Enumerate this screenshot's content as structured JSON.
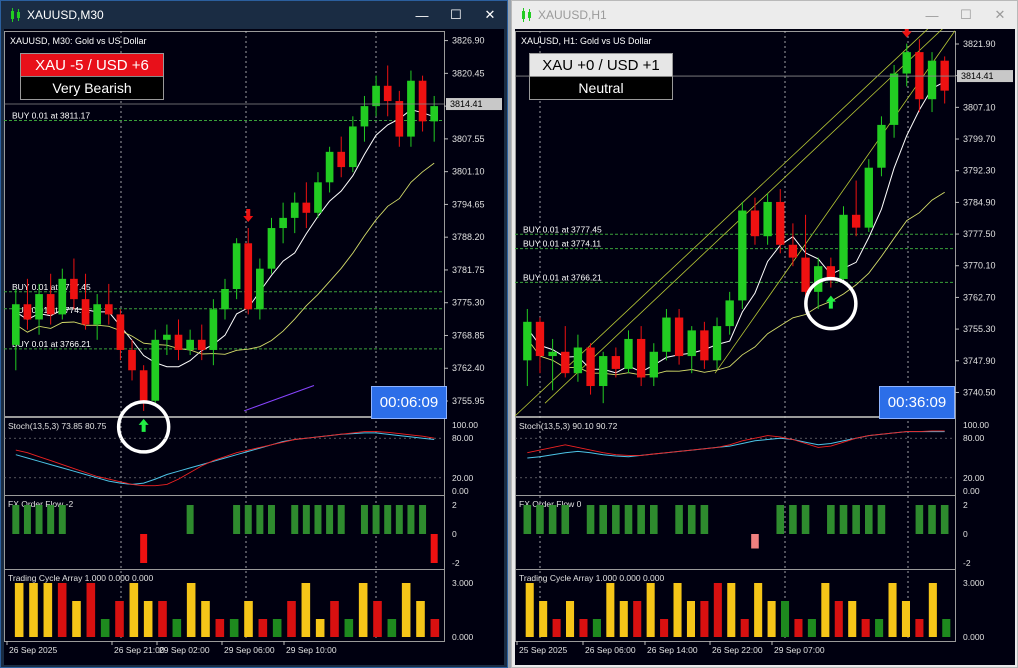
{
  "left": {
    "window_title": "XAUUSD,M30",
    "chart_header": "XAUUSD, M30:  Gold vs US Dollar",
    "badge_top": "XAU -5 / USD +6",
    "badge_bottom": "Very Bearish",
    "badge_top_bg": "#e8101a",
    "timer": "00:06:09",
    "current_price": "3814.41",
    "price_ticks": [
      "3826.90",
      "3820.45",
      "3814.00",
      "3807.55",
      "3801.10",
      "3794.65",
      "3788.20",
      "3781.75",
      "3775.30",
      "3768.85",
      "3762.40",
      "3755.95"
    ],
    "buy_labels": [
      "BUY 0.01 at 3811.17",
      "BUY 0.01 at 3777.45",
      "BUY 0.01 at 3774.11",
      "BUY 0.01 at 3766.21"
    ],
    "stoch_label": "Stoch(13,5,3) 73.85 80.75",
    "stoch_ticks": [
      "100.00",
      "80.00",
      "20.00",
      "0.00"
    ],
    "flow_label": "FX Order Flow -2",
    "flow_ticks": [
      "2",
      "0",
      "-2"
    ],
    "cycle_label": "Trading Cycle Array 1.000 0.000 0.000",
    "cycle_ticks": [
      "3.000",
      "0.000"
    ],
    "time_ticks": [
      "26 Sep 2025",
      "26 Sep 21:00",
      "29 Sep 02:00",
      "29 Sep 06:00",
      "29 Sep 10:00"
    ]
  },
  "right": {
    "window_title": "XAUUSD,H1",
    "chart_header": "XAUUSD, H1:  Gold vs US Dollar",
    "badge_top": "XAU +0 / USD +1",
    "badge_bottom": "Neutral",
    "badge_top_bg": "#e6e6e6",
    "timer": "00:36:09",
    "current_price": "3814.41",
    "price_ticks": [
      "3821.90",
      "3814.50",
      "3807.10",
      "3799.70",
      "3792.30",
      "3784.90",
      "3777.50",
      "3770.10",
      "3762.70",
      "3755.30",
      "3747.90",
      "3740.50"
    ],
    "buy_labels": [
      "BUY 0.01 at 3777.45",
      "BUY 0.01 at 3774.11",
      "BUY 0.01 at 3766.21"
    ],
    "stoch_label": "Stoch(13,5,3) 90.10 90.72",
    "stoch_ticks": [
      "100.00",
      "80.00",
      "20.00",
      "0.00"
    ],
    "flow_label": "FX Order Flow 0",
    "flow_ticks": [
      "2",
      "0",
      "-2"
    ],
    "cycle_label": "Trading Cycle Array 1.000 0.000 0.000",
    "cycle_ticks": [
      "3.000",
      "0.000"
    ],
    "time_ticks": [
      "25 Sep 2025",
      "26 Sep 06:00",
      "26 Sep 14:00",
      "26 Sep 22:00",
      "29 Sep 07:00"
    ]
  },
  "icons": {
    "window_icon": "candlestick-icon",
    "minimize": "minimize-icon",
    "maximize": "maximize-icon",
    "close": "close-icon",
    "up_arrow": "buy-arrow-icon",
    "down_arrow": "sell-arrow-icon"
  },
  "colors": {
    "bull": "#22cc22",
    "bear": "#ee1111",
    "grid": "#c8c8c8",
    "buy_line": "#3aa03a",
    "stoch_main": "#4cc3e6",
    "stoch_signal": "#ee2222",
    "cycle_yellow": "#f5c518",
    "cycle_red": "#d81010",
    "cycle_green": "#1e8a1e"
  },
  "chart_data": [
    {
      "type": "candlestick",
      "symbol": "XAUUSD",
      "timeframe": "M30",
      "ylim": [
        3753,
        3828
      ],
      "candles": [
        [
          3767,
          3778,
          3762,
          3775
        ],
        [
          3775,
          3780,
          3770,
          3772
        ],
        [
          3772,
          3779,
          3769,
          3777
        ],
        [
          3777,
          3781,
          3771,
          3773
        ],
        [
          3773,
          3782,
          3772,
          3780
        ],
        [
          3780,
          3784,
          3774,
          3776
        ],
        [
          3776,
          3781,
          3770,
          3771
        ],
        [
          3771,
          3777,
          3768,
          3775
        ],
        [
          3775,
          3779,
          3771,
          3773
        ],
        [
          3773,
          3774,
          3764,
          3766
        ],
        [
          3766,
          3768,
          3760,
          3762
        ],
        [
          3762,
          3763,
          3754,
          3756
        ],
        [
          3756,
          3770,
          3755,
          3768
        ],
        [
          3768,
          3771,
          3765,
          3769
        ],
        [
          3769,
          3772,
          3764,
          3766
        ],
        [
          3766,
          3770,
          3765,
          3768
        ],
        [
          3768,
          3771,
          3764,
          3766
        ],
        [
          3766,
          3776,
          3763,
          3774
        ],
        [
          3774,
          3780,
          3772,
          3778
        ],
        [
          3778,
          3788,
          3776,
          3787
        ],
        [
          3787,
          3790,
          3773,
          3774
        ],
        [
          3774,
          3784,
          3772,
          3782
        ],
        [
          3782,
          3792,
          3781,
          3790
        ],
        [
          3790,
          3795,
          3787,
          3792
        ],
        [
          3792,
          3797,
          3789,
          3795
        ],
        [
          3795,
          3799,
          3790,
          3793
        ],
        [
          3793,
          3801,
          3792,
          3799
        ],
        [
          3799,
          3806,
          3797,
          3805
        ],
        [
          3805,
          3808,
          3800,
          3802
        ],
        [
          3802,
          3812,
          3801,
          3810
        ],
        [
          3810,
          3816,
          3807,
          3814
        ],
        [
          3814,
          3820,
          3812,
          3818
        ],
        [
          3818,
          3822,
          3812,
          3815
        ],
        [
          3815,
          3817,
          3806,
          3808
        ],
        [
          3808,
          3821,
          3806,
          3819
        ],
        [
          3819,
          3820,
          3809,
          3811
        ],
        [
          3811,
          3816,
          3807,
          3814
        ]
      ],
      "stoch_main": [
        55,
        50,
        45,
        40,
        35,
        30,
        25,
        20,
        15,
        12,
        10,
        12,
        18,
        25,
        30,
        35,
        40,
        45,
        50,
        55,
        60,
        65,
        70,
        75,
        78,
        80,
        82,
        84,
        86,
        87,
        88,
        88,
        86,
        84,
        82,
        80,
        78
      ],
      "stoch_signal": [
        62,
        58,
        52,
        46,
        40,
        34,
        28,
        22,
        18,
        14,
        10,
        8,
        8,
        10,
        18,
        28,
        38,
        46,
        52,
        58,
        62,
        66,
        70,
        74,
        78,
        80,
        82,
        84,
        86,
        88,
        90,
        90,
        89,
        87,
        85,
        83,
        80
      ],
      "order_flow": [
        2,
        2,
        2,
        2,
        2,
        0,
        0,
        0,
        0,
        0,
        0,
        -2,
        0,
        0,
        0,
        2,
        0,
        0,
        0,
        2,
        2,
        2,
        2,
        0,
        2,
        2,
        2,
        2,
        2,
        0,
        2,
        2,
        2,
        2,
        2,
        2,
        -2
      ],
      "cycle": [
        [
          "y",
          3
        ],
        [
          "y",
          3
        ],
        [
          "y",
          3
        ],
        [
          "r",
          3
        ],
        [
          "y",
          2
        ],
        [
          "r",
          3
        ],
        [
          "g",
          1
        ],
        [
          "r",
          2
        ],
        [
          "y",
          3
        ],
        [
          "y",
          2
        ],
        [
          "r",
          2
        ],
        [
          "g",
          1
        ],
        [
          "y",
          3
        ],
        [
          "y",
          2
        ],
        [
          "r",
          1
        ],
        [
          "g",
          1
        ],
        [
          "y",
          2
        ],
        [
          "r",
          1
        ],
        [
          "g",
          1
        ],
        [
          "r",
          2
        ],
        [
          "y",
          3
        ],
        [
          "y",
          1
        ],
        [
          "r",
          2
        ],
        [
          "g",
          1
        ],
        [
          "y",
          3
        ],
        [
          "r",
          2
        ],
        [
          "g",
          1
        ],
        [
          "y",
          3
        ],
        [
          "y",
          2
        ],
        [
          "r",
          1
        ]
      ]
    },
    {
      "type": "candlestick",
      "symbol": "XAUUSD",
      "timeframe": "H1",
      "ylim": [
        3735,
        3824
      ],
      "candles": [
        [
          3748,
          3760,
          3742,
          3757
        ],
        [
          3757,
          3758,
          3745,
          3749
        ],
        [
          3749,
          3753,
          3741,
          3750
        ],
        [
          3750,
          3756,
          3744,
          3745
        ],
        [
          3745,
          3754,
          3743,
          3751
        ],
        [
          3751,
          3752,
          3740,
          3742
        ],
        [
          3742,
          3750,
          3738,
          3749
        ],
        [
          3749,
          3751,
          3744,
          3746
        ],
        [
          3746,
          3755,
          3745,
          3753
        ],
        [
          3753,
          3756,
          3742,
          3744
        ],
        [
          3744,
          3752,
          3742,
          3750
        ],
        [
          3750,
          3760,
          3748,
          3758
        ],
        [
          3758,
          3760,
          3747,
          3749
        ],
        [
          3749,
          3756,
          3745,
          3755
        ],
        [
          3755,
          3757,
          3746,
          3748
        ],
        [
          3748,
          3758,
          3746,
          3756
        ],
        [
          3756,
          3764,
          3754,
          3762
        ],
        [
          3762,
          3785,
          3760,
          3783
        ],
        [
          3783,
          3786,
          3775,
          3777
        ],
        [
          3777,
          3787,
          3775,
          3785
        ],
        [
          3785,
          3788,
          3773,
          3775
        ],
        [
          3775,
          3780,
          3770,
          3772
        ],
        [
          3772,
          3782,
          3762,
          3764
        ],
        [
          3764,
          3772,
          3760,
          3770
        ],
        [
          3770,
          3772,
          3765,
          3767
        ],
        [
          3767,
          3784,
          3766,
          3782
        ],
        [
          3782,
          3790,
          3777,
          3779
        ],
        [
          3779,
          3795,
          3778,
          3793
        ],
        [
          3793,
          3805,
          3791,
          3803
        ],
        [
          3803,
          3817,
          3800,
          3815
        ],
        [
          3815,
          3822,
          3812,
          3820
        ],
        [
          3820,
          3823,
          3806,
          3809
        ],
        [
          3809,
          3820,
          3806,
          3818
        ],
        [
          3818,
          3819,
          3808,
          3811
        ]
      ],
      "stoch_main": [
        50,
        52,
        55,
        58,
        60,
        58,
        55,
        53,
        52,
        54,
        56,
        58,
        60,
        62,
        64,
        66,
        68,
        72,
        76,
        78,
        80,
        78,
        74,
        70,
        72,
        76,
        80,
        84,
        86,
        88,
        90,
        90,
        90,
        90
      ],
      "stoch_signal": [
        58,
        62,
        66,
        70,
        66,
        62,
        58,
        55,
        54,
        54,
        56,
        58,
        60,
        62,
        64,
        66,
        70,
        76,
        80,
        84,
        82,
        78,
        72,
        66,
        68,
        74,
        80,
        84,
        86,
        88,
        90,
        90,
        91,
        91
      ],
      "order_flow": [
        2,
        2,
        2,
        2,
        0,
        2,
        2,
        2,
        2,
        2,
        2,
        0,
        2,
        2,
        2,
        0,
        0,
        0,
        -1,
        0,
        2,
        2,
        2,
        0,
        2,
        2,
        2,
        2,
        2,
        0,
        0,
        2,
        2,
        2
      ],
      "cycle": [
        [
          "y",
          3
        ],
        [
          "y",
          2
        ],
        [
          "r",
          1
        ],
        [
          "y",
          2
        ],
        [
          "r",
          1
        ],
        [
          "g",
          1
        ],
        [
          "y",
          3
        ],
        [
          "y",
          2
        ],
        [
          "r",
          2
        ],
        [
          "y",
          3
        ],
        [
          "r",
          1
        ],
        [
          "y",
          3
        ],
        [
          "y",
          2
        ],
        [
          "r",
          2
        ],
        [
          "r",
          3
        ],
        [
          "y",
          3
        ],
        [
          "r",
          1
        ],
        [
          "y",
          3
        ],
        [
          "y",
          2
        ],
        [
          "g",
          2
        ],
        [
          "r",
          1
        ],
        [
          "g",
          1
        ],
        [
          "y",
          3
        ],
        [
          "r",
          2
        ],
        [
          "y",
          2
        ],
        [
          "r",
          1
        ],
        [
          "g",
          1
        ],
        [
          "y",
          3
        ],
        [
          "y",
          2
        ],
        [
          "r",
          1
        ],
        [
          "y",
          3
        ],
        [
          "g",
          1
        ]
      ]
    }
  ]
}
